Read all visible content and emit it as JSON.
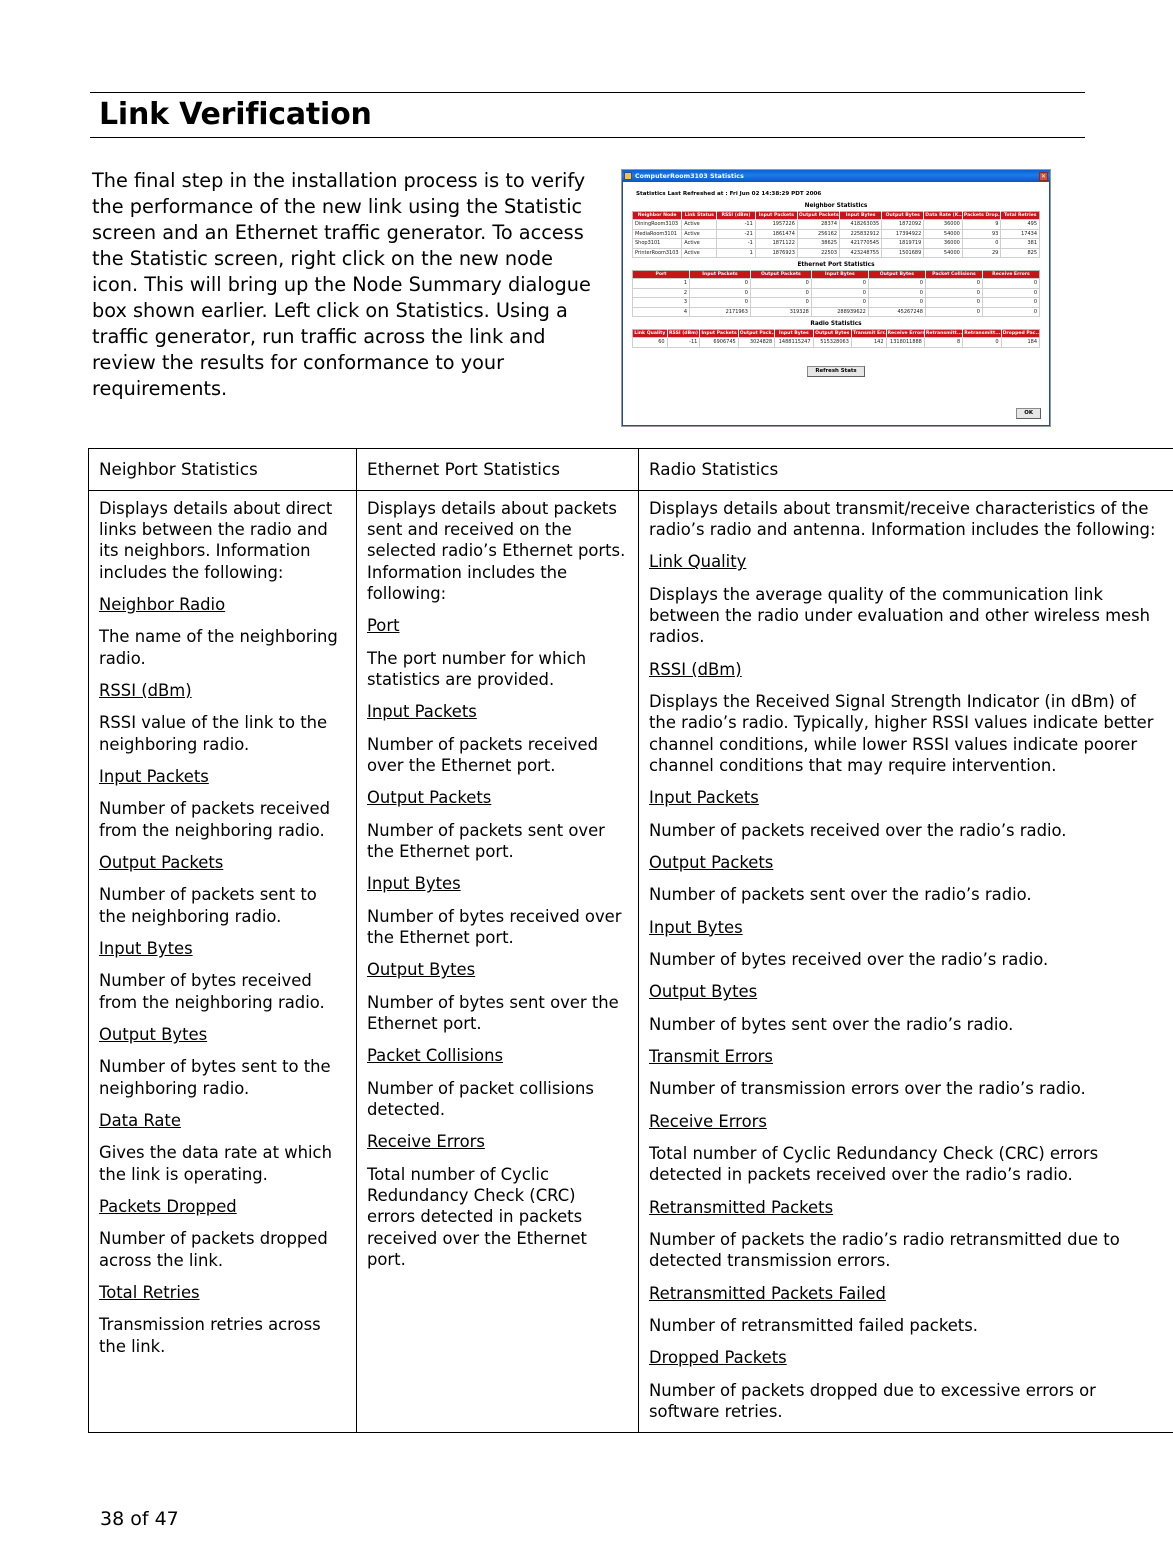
{
  "document": {
    "title": "Link Verification",
    "intro": " The final step in the installation process is to verify the performance of the new link using the Statistic screen and an Ethernet traffic generator. To access the Statistic screen, right click on the new node icon. This will bring up the Node Summary dialogue box shown earlier. Left click on Statistics. Using a traffic generator, run traffic across the link and review the results for conformance to your requirements.",
    "footer": "38 of 47"
  },
  "screenshot": {
    "window_title": "ComputerRoom3103 Statistics",
    "close_label": "✕",
    "refreshed_line": "Statistics Last Refreshed at :  Fri Jun 02 14:38:29 PDT 2006",
    "neighbor": {
      "section_title": "Neighbor Statistics",
      "columns": [
        "Neighbor Node",
        "Link Status",
        "RSSI (dBm)",
        "Input Packets",
        "Output Packets",
        "Input Bytes",
        "Output Bytes",
        "Data Rate (K...",
        "Packets Drop...",
        "Total Retries"
      ],
      "rows": [
        [
          "DiningRoom3103",
          "Active",
          "-11",
          "1957226",
          "28374",
          "418263035",
          "1872092",
          "36000",
          "9",
          "495"
        ],
        [
          "MediaRoom3101",
          "Active",
          "-21",
          "1861474",
          "256162",
          "225832912",
          "17394922",
          "54000",
          "93",
          "17434"
        ],
        [
          "Shop3101",
          "Active",
          "-1",
          "1871122",
          "38625",
          "421770545",
          "1819719",
          "36000",
          "0",
          "381"
        ],
        [
          "PrinterRoom3103",
          "Active",
          "1",
          "1876923",
          "22503",
          "423248755",
          "1501689",
          "54000",
          "29",
          "825"
        ]
      ]
    },
    "ethernet": {
      "section_title": "Ethernet Port Statistics",
      "columns": [
        "Port",
        "Input Packets",
        "Output Packets",
        "Input Bytes",
        "Output Bytes",
        "Packet Collisions",
        "Receive Errors"
      ],
      "rows": [
        [
          "1",
          "0",
          "0",
          "0",
          "0",
          "0",
          "0"
        ],
        [
          "2",
          "0",
          "0",
          "0",
          "0",
          "0",
          "0"
        ],
        [
          "3",
          "0",
          "0",
          "0",
          "0",
          "0",
          "0"
        ],
        [
          "4",
          "2171963",
          "319328",
          "288939622",
          "45267248",
          "0",
          "0"
        ]
      ]
    },
    "radio": {
      "section_title": "Radio Statistics",
      "columns": [
        "Link Quality",
        "RSSI (dBm)",
        "Input Packets",
        "Output Pack...",
        "Input Bytes",
        "Output Bytes",
        "Transmit Err..",
        "Receive Errors",
        "Retransmitt...",
        "Retransmitt...",
        "Dropped Pac..."
      ],
      "rows": [
        [
          "60",
          "-11",
          "6906745",
          "3024828",
          "1488115247",
          "515328063",
          "142",
          "1318011888",
          "8",
          "0",
          "184"
        ]
      ]
    },
    "buttons": {
      "refresh": "Refresh Stats",
      "ok": "OK"
    }
  },
  "deftable": {
    "headers": {
      "neighbor": "Neighbor Statistics",
      "ethernet": "Ethernet Port Statistics",
      "radio": "Radio Statistics"
    },
    "neighbor": {
      "intro": "Displays details about direct links between the radio and its  neighbors. Information includes the following:",
      "entries": [
        {
          "term": "Neighbor Radio",
          "desc": "The name of the neighboring radio."
        },
        {
          "term": "RSSI (dBm)",
          "desc": "RSSI value of the link to the neighboring radio."
        },
        {
          "term": "Input Packets",
          "desc": "Number of packets received from the neighboring radio."
        },
        {
          "term": "Output Packets",
          "desc": "Number of packets sent to the neighboring radio."
        },
        {
          "term": "Input Bytes",
          "desc": "Number of bytes received from the neighboring radio."
        },
        {
          "term": "Output Bytes",
          "desc": "Number of bytes sent to the neighboring radio."
        },
        {
          "term": "Data Rate",
          "desc": "Gives the data rate at which the link is operating."
        },
        {
          "term": "Packets Dropped",
          "desc": "Number of packets dropped across the link."
        },
        {
          "term": "Total Retries",
          "desc": "Transmission retries across the link."
        }
      ]
    },
    "ethernet": {
      "intro": "Displays details about packets sent and received on the selected radio’s Ethernet ports. Information includes the following:",
      "entries": [
        {
          "term": "Port",
          "desc": "The port number for which statistics are provided."
        },
        {
          "term": "Input Packets",
          "desc": "Number of packets received over the Ethernet port."
        },
        {
          "term": "Output Packets",
          "desc": "Number of packets sent over the Ethernet port."
        },
        {
          "term": "Input Bytes",
          "desc": "Number of bytes received over the Ethernet port."
        },
        {
          "term": "Output Bytes",
          "desc": "Number of bytes sent over the Ethernet port."
        },
        {
          "term": "Packet Collisions",
          "desc": "Number of packet collisions detected."
        },
        {
          "term": "Receive Errors",
          "desc": "Total number of Cyclic Redundancy Check (CRC) errors detected in packets received over the Ethernet port."
        }
      ]
    },
    "radio": {
      "intro": "Displays details about transmit/receive characteristics of the radio’s radio and antenna. Information includes the following:",
      "entries": [
        {
          "term": "Link Quality",
          "desc": "Displays the average quality of the communication link between the radio under evaluation and other wireless mesh radios."
        },
        {
          "term": "RSSI (dBm)",
          "desc": "Displays the Received Signal Strength Indicator (in dBm) of the radio’s radio. Typically, higher RSSI values indicate better channel conditions, while lower RSSI values indicate poorer channel conditions that may require intervention."
        },
        {
          "term": "Input Packets",
          "desc": "Number of packets received over the radio’s radio."
        },
        {
          "term": "Output Packets",
          "desc": "Number of packets sent over the radio’s radio."
        },
        {
          "term": "Input Bytes",
          "desc": "Number of bytes received over the radio’s radio."
        },
        {
          "term": "Output Bytes",
          "desc": "Number of bytes sent over the radio’s radio."
        },
        {
          "term": "Transmit Errors",
          "desc": "Number of transmission errors over the radio’s radio."
        },
        {
          "term": "Receive Errors",
          "desc": "Total number of Cyclic Redundancy Check (CRC) errors detected in packets received over the radio’s radio."
        },
        {
          "term": "Retransmitted Packets",
          "desc": "Number of packets the radio’s radio retransmitted due to detected transmission errors."
        },
        {
          "term": "Retransmitted Packets Failed",
          "desc": "Number of retransmitted failed packets."
        },
        {
          "term": "Dropped Packets",
          "desc": "Number of packets dropped due to excessive errors or software retries."
        }
      ]
    }
  }
}
